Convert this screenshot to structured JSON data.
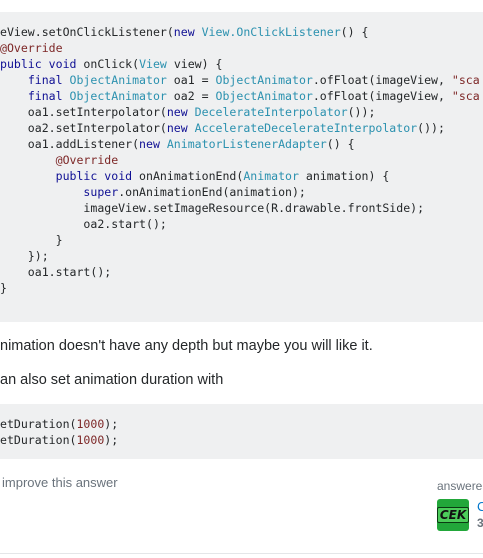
{
  "code_main": {
    "lines": [
      [
        {
          "t": "eView.setOnClickListener(",
          "c": ""
        },
        {
          "t": "new",
          "c": "kw"
        },
        {
          "t": " ",
          "c": ""
        },
        {
          "t": "View.OnClickListener",
          "c": "ty"
        },
        {
          "t": "() {",
          "c": ""
        }
      ],
      [
        {
          "t": "@Override",
          "c": "an"
        }
      ],
      [
        {
          "t": "public",
          "c": "kw"
        },
        {
          "t": " ",
          "c": ""
        },
        {
          "t": "void",
          "c": "kw"
        },
        {
          "t": " onClick(",
          "c": ""
        },
        {
          "t": "View",
          "c": "ty"
        },
        {
          "t": " view) {",
          "c": ""
        }
      ],
      [
        {
          "t": "    ",
          "c": ""
        },
        {
          "t": "final",
          "c": "kw"
        },
        {
          "t": " ",
          "c": ""
        },
        {
          "t": "ObjectAnimator",
          "c": "ty"
        },
        {
          "t": " oa1 = ",
          "c": ""
        },
        {
          "t": "ObjectAnimator",
          "c": "ty"
        },
        {
          "t": ".ofFloat(imageView, ",
          "c": ""
        },
        {
          "t": "\"sca",
          "c": "st"
        }
      ],
      [
        {
          "t": "    ",
          "c": ""
        },
        {
          "t": "final",
          "c": "kw"
        },
        {
          "t": " ",
          "c": ""
        },
        {
          "t": "ObjectAnimator",
          "c": "ty"
        },
        {
          "t": " oa2 = ",
          "c": ""
        },
        {
          "t": "ObjectAnimator",
          "c": "ty"
        },
        {
          "t": ".ofFloat(imageView, ",
          "c": ""
        },
        {
          "t": "\"sca",
          "c": "st"
        }
      ],
      [
        {
          "t": "    oa1.setInterpolator(",
          "c": ""
        },
        {
          "t": "new",
          "c": "kw"
        },
        {
          "t": " ",
          "c": ""
        },
        {
          "t": "DecelerateInterpolator",
          "c": "ty"
        },
        {
          "t": "());",
          "c": ""
        }
      ],
      [
        {
          "t": "    oa2.setInterpolator(",
          "c": ""
        },
        {
          "t": "new",
          "c": "kw"
        },
        {
          "t": " ",
          "c": ""
        },
        {
          "t": "AccelerateDecelerateInterpolator",
          "c": "ty"
        },
        {
          "t": "());",
          "c": ""
        }
      ],
      [
        {
          "t": "    oa1.addListener(",
          "c": ""
        },
        {
          "t": "new",
          "c": "kw"
        },
        {
          "t": " ",
          "c": ""
        },
        {
          "t": "AnimatorListenerAdapter",
          "c": "ty"
        },
        {
          "t": "() {",
          "c": ""
        }
      ],
      [
        {
          "t": "        ",
          "c": ""
        },
        {
          "t": "@Override",
          "c": "an"
        }
      ],
      [
        {
          "t": "        ",
          "c": ""
        },
        {
          "t": "public",
          "c": "kw"
        },
        {
          "t": " ",
          "c": ""
        },
        {
          "t": "void",
          "c": "kw"
        },
        {
          "t": " onAnimationEnd(",
          "c": ""
        },
        {
          "t": "Animator",
          "c": "ty"
        },
        {
          "t": " animation) {",
          "c": ""
        }
      ],
      [
        {
          "t": "            ",
          "c": ""
        },
        {
          "t": "super",
          "c": "kw"
        },
        {
          "t": ".onAnimationEnd(animation);",
          "c": ""
        }
      ],
      [
        {
          "t": "            imageView.setImageResource(R.drawable.frontSide);",
          "c": ""
        }
      ],
      [
        {
          "t": "            oa2.start();",
          "c": ""
        }
      ],
      [
        {
          "t": "        }",
          "c": ""
        }
      ],
      [
        {
          "t": "    });",
          "c": ""
        }
      ],
      [
        {
          "t": "    oa1.start();",
          "c": ""
        }
      ],
      [
        {
          "t": "}",
          "c": ""
        }
      ]
    ]
  },
  "prose": {
    "line1": "nimation doesn't have any depth but maybe you will like it.",
    "line2": "an also set animation duration with"
  },
  "code_duration": {
    "lines": [
      [
        {
          "t": "etDuration(",
          "c": ""
        },
        {
          "t": "1000",
          "c": "nu"
        },
        {
          "t": ");",
          "c": ""
        }
      ],
      [
        {
          "t": "etDuration(",
          "c": ""
        },
        {
          "t": "1000",
          "c": "nu"
        },
        {
          "t": ");",
          "c": ""
        }
      ]
    ]
  },
  "post_menu": {
    "improve_label": "improve this answer"
  },
  "user_card": {
    "action_label": "answere",
    "avatar_text": "CEK",
    "name": "C",
    "reputation": "3"
  },
  "colors": {
    "code_bg": "#eff0f1",
    "keyword": "#101094",
    "type": "#2b91af",
    "literal": "#7d2727",
    "link": "#0077cc",
    "avatar_bg": "#22a73a"
  }
}
